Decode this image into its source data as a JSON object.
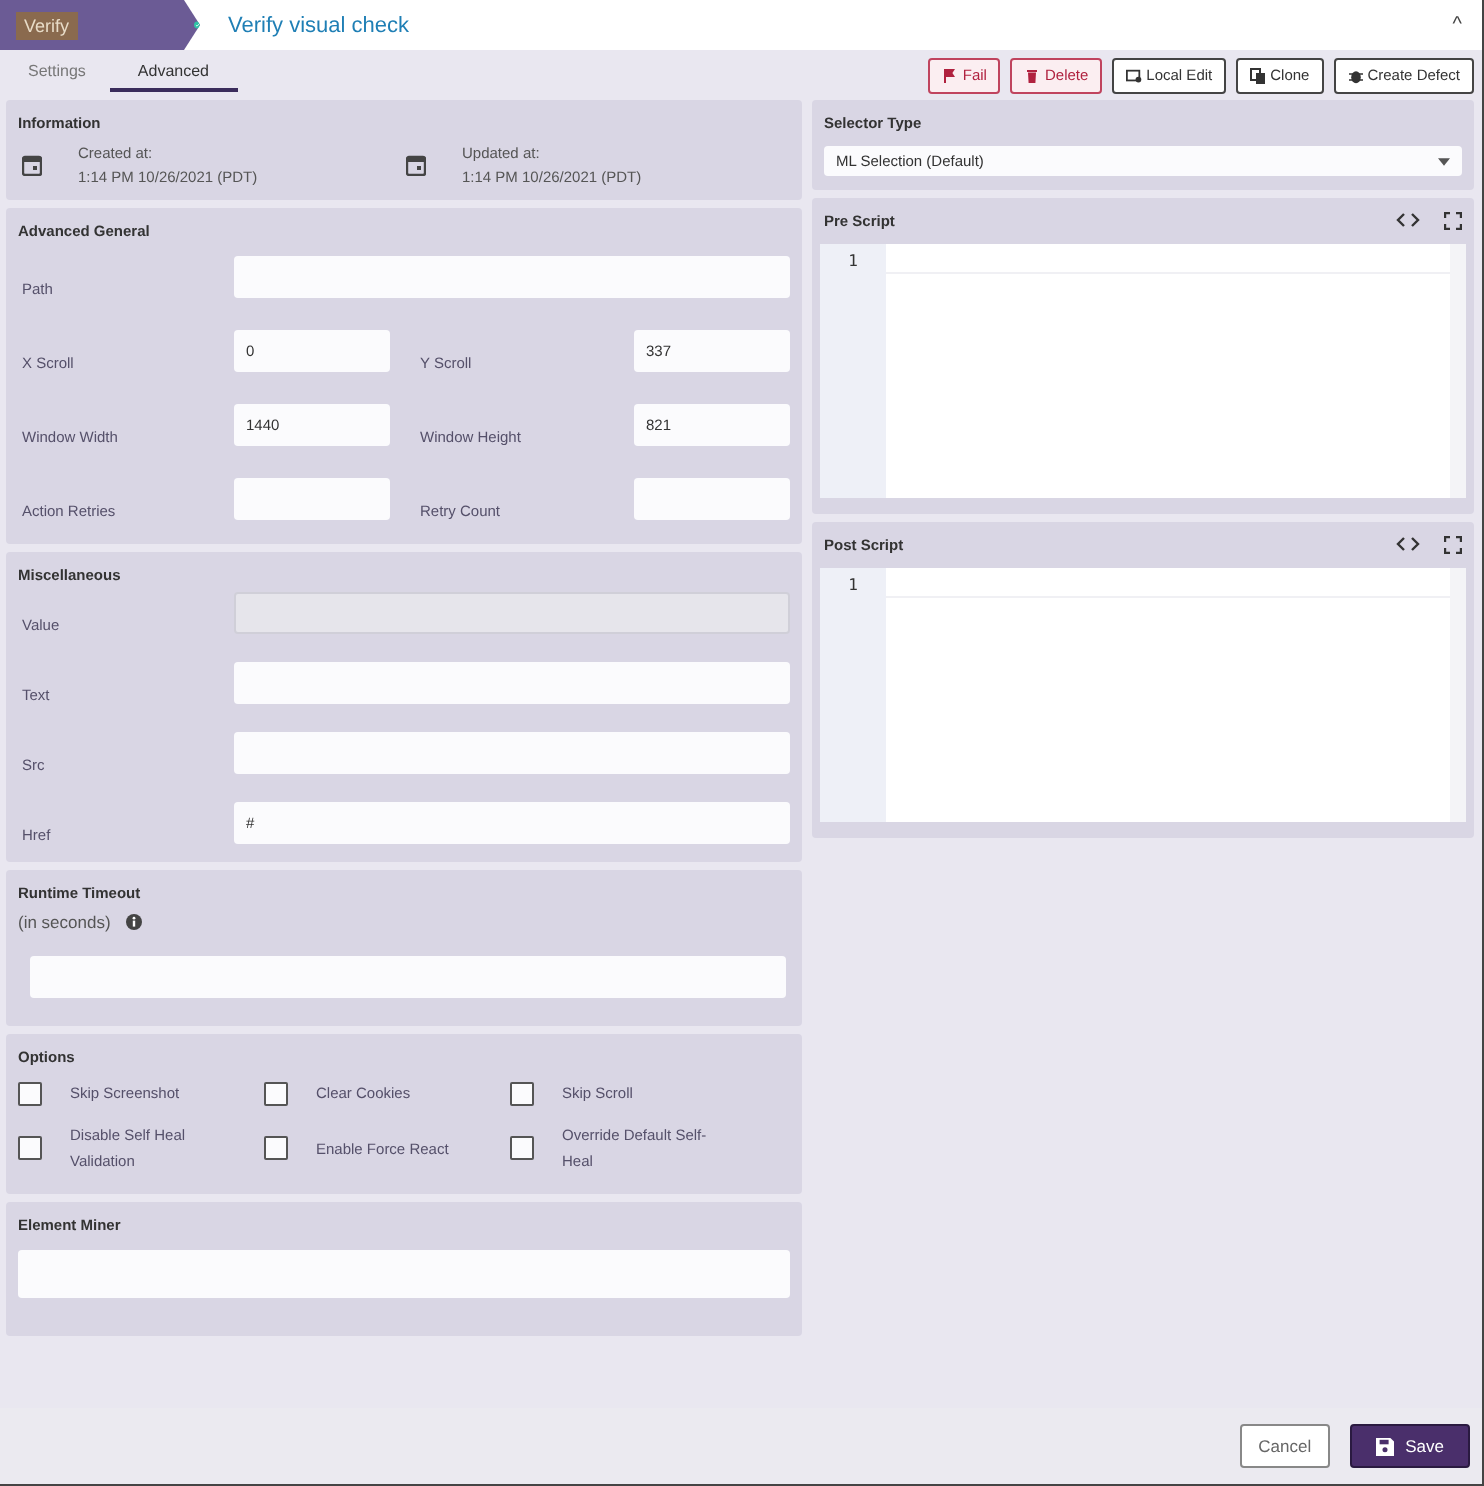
{
  "header": {
    "badge": "Verify",
    "verified": true,
    "title": "Verify visual check",
    "collapse": "^"
  },
  "tabs": [
    {
      "label": "Settings",
      "selected": false
    },
    {
      "label": "Advanced",
      "selected": true
    }
  ],
  "actions": [
    {
      "label": "Fail",
      "kind": "danger"
    },
    {
      "label": "Delete",
      "kind": "danger"
    },
    {
      "label": "Local Edit",
      "kind": "default"
    },
    {
      "label": "Clone",
      "kind": "default"
    },
    {
      "label": "Create Defect",
      "kind": "default"
    }
  ],
  "information": {
    "title": "Information",
    "dates": [
      {
        "label": "Created at:",
        "value": "1:14 PM 10/26/2021 (PDT)"
      },
      {
        "label": "Updated at:",
        "value": "1:14 PM 10/26/2021 (PDT)"
      }
    ]
  },
  "advanced_general": {
    "title": "Advanced General",
    "fields": [
      {
        "label": "Path",
        "kind": "wide"
      },
      {
        "label": "X Scroll",
        "value": "0",
        "kind": "narrow"
      },
      {
        "label": "Y Scroll",
        "value": "337",
        "kind": "narrow"
      },
      {
        "label": "Window Width",
        "value": "1440",
        "kind": "narrow"
      },
      {
        "label": "Window Height",
        "value": "821",
        "kind": "narrow"
      },
      {
        "label": "Action Retries",
        "kind": "narrow"
      },
      {
        "label": "Retry Count",
        "kind": "narrow"
      }
    ]
  },
  "miscellaneous": {
    "title": "Miscellaneous",
    "fields": [
      {
        "label": "Value",
        "disabled": true
      },
      {
        "label": "Text",
        "disabled": false
      },
      {
        "label": "Src",
        "disabled": false
      },
      {
        "label": "Href",
        "value": "#",
        "disabled": false
      }
    ]
  },
  "runtime_timeout": {
    "title": "Runtime Timeout",
    "subtitle": "(in seconds)"
  },
  "options": {
    "title": "Options",
    "items": [
      {
        "label": "Skip Screenshot",
        "checked": false
      },
      {
        "label": "Clear Cookies",
        "checked": false
      },
      {
        "label": "Skip Scroll",
        "checked": false
      },
      {
        "label": "Disable Self Heal Validation",
        "checked": false
      },
      {
        "label": "Enable Force React",
        "checked": false
      },
      {
        "label": "Override Default Self-Heal",
        "checked": false
      }
    ]
  },
  "element_miner": {
    "title": "Element Miner"
  },
  "selector_type": {
    "title": "Selector Type",
    "value": "ML Selection (Default)"
  },
  "scripts": [
    {
      "title": "Pre Script",
      "line_numbers": [
        "1"
      ]
    },
    {
      "title": "Post Script",
      "line_numbers": [
        "1"
      ]
    }
  ],
  "footer": [
    {
      "label": "Cancel",
      "kind": "secondary"
    },
    {
      "label": "Save",
      "kind": "primary"
    }
  ]
}
